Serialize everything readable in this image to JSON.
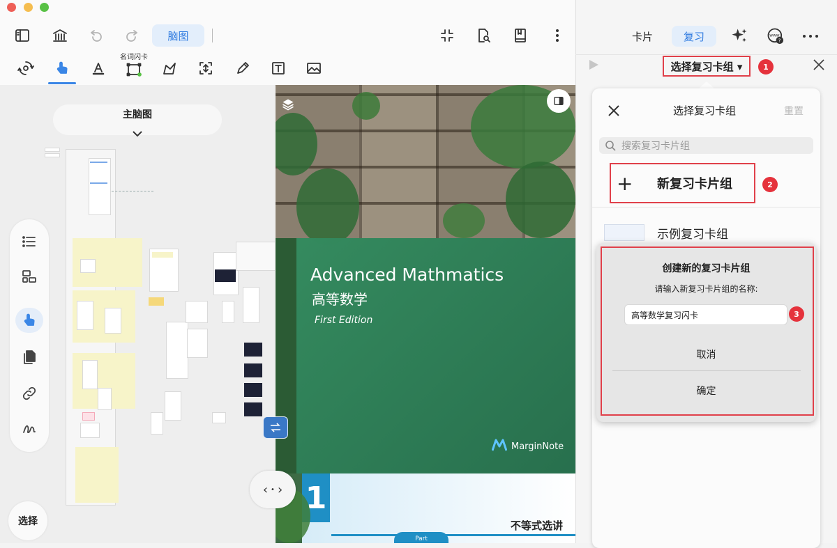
{
  "toolbar": {
    "mindmap_tab": "脑图",
    "tool_label": "名词闪卡"
  },
  "mindmap": {
    "title": "主脑图",
    "select_button": "选择"
  },
  "document": {
    "title_en": "Advanced Mathmatics",
    "title_cn": "高等数学",
    "edition": "First Edition",
    "brand": "MarginNote",
    "page2_number": "1",
    "page2_title": "不等式选讲",
    "page2_badge": "Part"
  },
  "right_panel": {
    "tabs": [
      "卡片",
      "复习"
    ],
    "deck_selector": "选择复习卡组 ▾",
    "popover": {
      "title": "选择复习卡组",
      "reset": "重置",
      "search_placeholder": "搜索复习卡片组",
      "new_group": "新复习卡片组",
      "new_group_plus": "+",
      "example_group": "示例复习卡组"
    },
    "dialog": {
      "title": "创建新的复习卡片组",
      "message": "请输入新复习卡片组的名称:",
      "input_value": "高等数学复习闪卡",
      "cancel": "取消",
      "confirm": "确定"
    },
    "badges": [
      "1",
      "2",
      "3"
    ]
  },
  "colors": {
    "accent": "#2f7be0",
    "highlight": "#e0404a",
    "cover_green": "#348c60"
  }
}
